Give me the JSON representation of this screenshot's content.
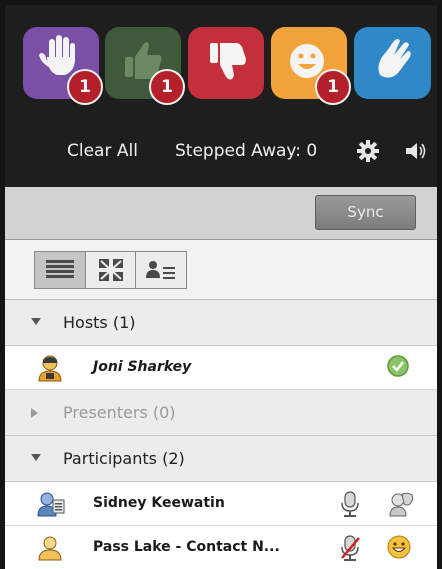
{
  "status": {
    "buttons": [
      {
        "name": "raise-hand",
        "color": "#7a4fa6",
        "count": "1"
      },
      {
        "name": "agree",
        "color": "#3f5a3a",
        "count": "1"
      },
      {
        "name": "disagree",
        "color": "#c42f3c",
        "count": ""
      },
      {
        "name": "laughter",
        "color": "#f2a33a",
        "count": "1"
      },
      {
        "name": "applause",
        "color": "#2f88c8",
        "count": ""
      }
    ],
    "clear_all": "Clear All",
    "stepped_away": "Stepped Away: 0"
  },
  "toolbar": {
    "sync_label": "Sync"
  },
  "view_buttons": [
    "list-view-icon",
    "grid-view-icon",
    "attendee-details-icon"
  ],
  "sections": {
    "hosts": "Hosts (1)",
    "presenters": "Presenters (0)",
    "participants": "Participants (2)"
  },
  "hosts": [
    {
      "name": "Joni Sharkey",
      "status_icon": "agree-check-icon"
    }
  ],
  "participants": [
    {
      "name": "Sidney Keewatin",
      "mic_icon": "microphone-icon",
      "status_icon": "participant-rights-icon"
    },
    {
      "name": "Pass Lake - Contact N...",
      "mic_icon": "microphone-muted-icon",
      "status_icon": "laughter-icon"
    }
  ]
}
